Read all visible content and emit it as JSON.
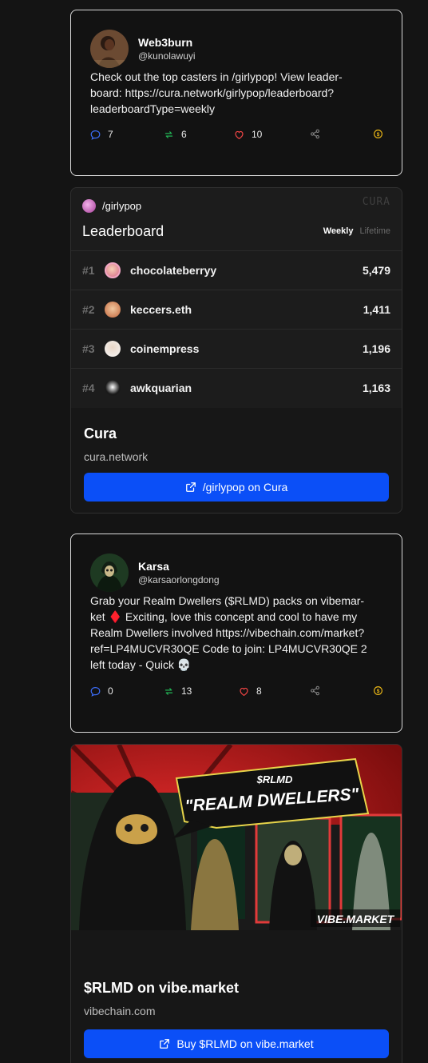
{
  "post1": {
    "author_name": "Web3burn",
    "author_handle": "@kunolawuyi",
    "text": "Check out the top casters in /girlypop! View leader-board: https://cura.network/girlypop/leaderboard?leaderboardType=weekly",
    "replies": "7",
    "recasts": "6",
    "likes": "10",
    "icons": [
      "reply-icon",
      "recast-icon",
      "heart-icon",
      "share-icon",
      "tip-icon"
    ]
  },
  "leaderboard_card": {
    "channel": "/girlypop",
    "brand_mark": "CURA",
    "title": "Leaderboard",
    "tabs": [
      "Weekly",
      "Lifetime"
    ],
    "active_tab": "Weekly",
    "rows": [
      {
        "rank": "#1",
        "user": "chocolateberryy",
        "score": "5,479"
      },
      {
        "rank": "#2",
        "user": "keccers.eth",
        "score": "1,411"
      },
      {
        "rank": "#3",
        "user": "coinempress",
        "score": "1,196"
      },
      {
        "rank": "#4",
        "user": "awkquarian",
        "score": "1,163"
      }
    ],
    "footer_title": "Cura",
    "footer_domain": "cura.network",
    "cta_label": "/girlypop on Cura"
  },
  "post2": {
    "author_name": "Karsa",
    "author_handle": "@karsaorlongdong",
    "text": "Grab your Realm Dwellers ($RLMD) packs on vibemar-ket ♦️ Exciting, love this concept and cool to have my Realm Dwellers involved https://vibechain.com/market?ref=LP4MUCVR30QE Code to join: LP4MUCVR30QE 2 left today - Quick 💀",
    "replies": "0",
    "recasts": "13",
    "likes": "8"
  },
  "vibe_card": {
    "banner_ticker": "$RLMD",
    "banner_title": "\"REALM DWELLERS\"",
    "banner_brand": "VIBE.MARKET",
    "footer_title": "$RLMD on vibe.market",
    "footer_domain": "vibechain.com",
    "cta_label": "Buy $RLMD on vibe.market"
  },
  "colors": {
    "reply": "#3b6cf6",
    "recast": "#22b455",
    "like": "#ef4444",
    "share": "#8a8a8a",
    "tip": "#e7b416",
    "cta": "#0b4ff7"
  }
}
